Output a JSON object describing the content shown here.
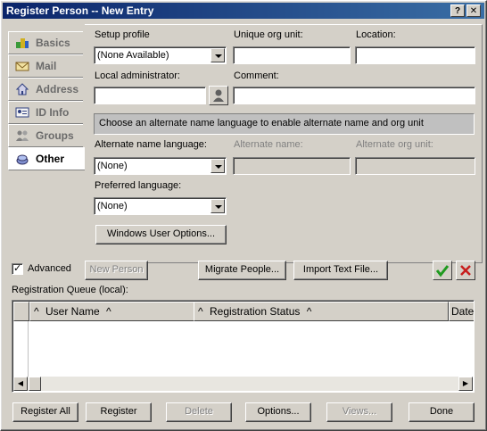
{
  "window": {
    "title": "Register Person -- New Entry",
    "help_glyph": "?",
    "close_glyph": "✕"
  },
  "nav": {
    "items": [
      {
        "label": "Basics",
        "icon": "basics-icon"
      },
      {
        "label": "Mail",
        "icon": "mail-icon"
      },
      {
        "label": "Address",
        "icon": "address-icon"
      },
      {
        "label": "ID Info",
        "icon": "id-info-icon"
      },
      {
        "label": "Groups",
        "icon": "groups-icon"
      },
      {
        "label": "Other",
        "icon": "other-icon",
        "active": true
      }
    ]
  },
  "form": {
    "setup_profile_label": "Setup profile",
    "setup_profile_value": "(None Available)",
    "unique_org_unit_label": "Unique org unit:",
    "unique_org_unit_value": "",
    "location_label": "Location:",
    "location_value": "",
    "local_admin_label": "Local administrator:",
    "local_admin_value": "",
    "comment_label": "Comment:",
    "comment_value": "",
    "banner_text": "Choose an alternate name language to enable alternate name and org unit",
    "alt_name_language_label": "Alternate name language:",
    "alt_name_language_value": "(None)",
    "alt_name_label": "Alternate name:",
    "alt_name_value": "",
    "alt_org_unit_label": "Alternate org unit:",
    "alt_org_unit_value": "",
    "preferred_language_label": "Preferred language:",
    "preferred_language_value": "(None)",
    "windows_user_options_label": "Windows User Options..."
  },
  "middle": {
    "advanced_label": "Advanced",
    "new_person_label": "New Person",
    "migrate_people_label": "Migrate People...",
    "import_text_file_label": "Import Text File...",
    "queue_label": "Registration Queue (local):"
  },
  "grid": {
    "columns": [
      "User Name",
      "Registration Status",
      "Date"
    ],
    "sort_glyph": "^",
    "rows": []
  },
  "footer": {
    "register_all_label": "Register All",
    "register_label": "Register",
    "delete_label": "Delete",
    "options_label": "Options...",
    "views_label": "Views...",
    "done_label": "Done"
  },
  "colors": {
    "title_start": "#0a246a",
    "title_end": "#3a6ea5",
    "ok_green": "#1f9a1f",
    "cancel_red": "#c81e1e"
  }
}
